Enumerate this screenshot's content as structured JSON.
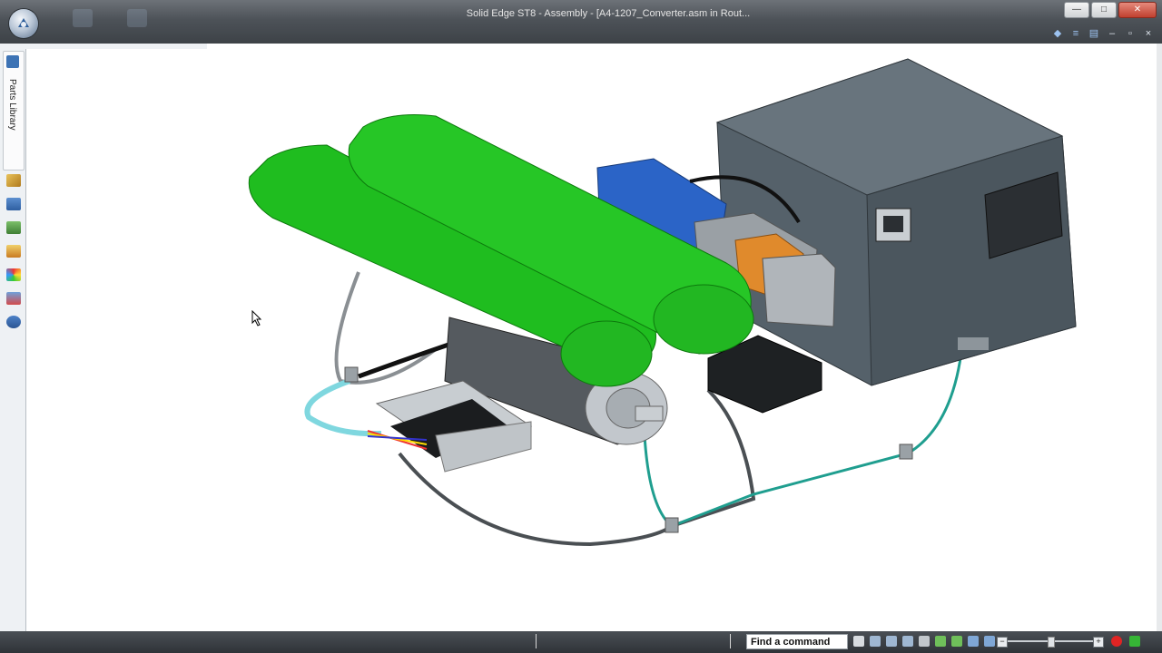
{
  "window": {
    "title": "Solid Edge ST8 - Assembly - [A4-1207_Converter.asm in Rout...",
    "buttons": {
      "minimize": "—",
      "maximize": "□",
      "close": "✕"
    }
  },
  "doc_controls": {
    "icons": [
      "help-icon",
      "options-icon",
      "window-icon"
    ],
    "minimize": "–",
    "restore": "▫",
    "close": "×"
  },
  "left_panel": {
    "tab_label": "Parts Library",
    "icons": [
      "parts-library-icon",
      "layers-icon",
      "assembly-tree-icon",
      "sensors-icon",
      "color-icon",
      "layout-icon",
      "settings-icon"
    ]
  },
  "status_bar": {
    "command_finder_label": "Find a command",
    "view_icons": [
      "arrow-icon",
      "fit-icon",
      "zoom-area-icon",
      "zoom-icon",
      "pan-icon",
      "rotate-icon",
      "orient-icon",
      "render-icon",
      "view-style-icon",
      "section-icon"
    ],
    "zoom_level": 0.5
  },
  "colors": {
    "battery_green": "#1fbd1f",
    "plc_gray": "#55616a",
    "terminal_blue": "#2b64c7",
    "terminal_orange": "#e08a2c",
    "cable_teal": "#1f9e8f",
    "cable_cyan": "#7fd7df"
  }
}
